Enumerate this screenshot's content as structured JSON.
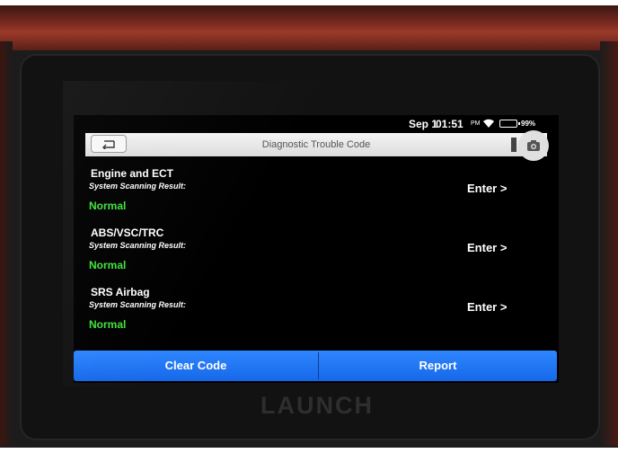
{
  "statusbar": {
    "date": "Sep 1",
    "time": "01:51",
    "ampm": "PM",
    "battery": "99%",
    "wifi_icon": "wifi-icon",
    "battery_icon": "battery-icon"
  },
  "header": {
    "title": "Diagnostic Trouble Code",
    "back_icon": "back-arrow-icon",
    "screenshot_icon": "camera-icon"
  },
  "systems": [
    {
      "name": "Engine and ECT",
      "scan_label": "System Scanning Result:",
      "result": "Normal",
      "enter_label": "Enter >"
    },
    {
      "name": "ABS/VSC/TRC",
      "scan_label": "System Scanning Result:",
      "result": "Normal",
      "enter_label": "Enter >"
    },
    {
      "name": "SRS Airbag",
      "scan_label": "System Scanning Result:",
      "result": "Normal",
      "enter_label": "Enter >"
    }
  ],
  "footer": {
    "clear_code_label": "Clear Code",
    "report_label": "Report"
  },
  "device": {
    "brand": "LAUNCH"
  },
  "colors": {
    "result_normal": "#3fe23b",
    "button_blue": "#1f74f0",
    "device_red": "#9b3a2a"
  }
}
